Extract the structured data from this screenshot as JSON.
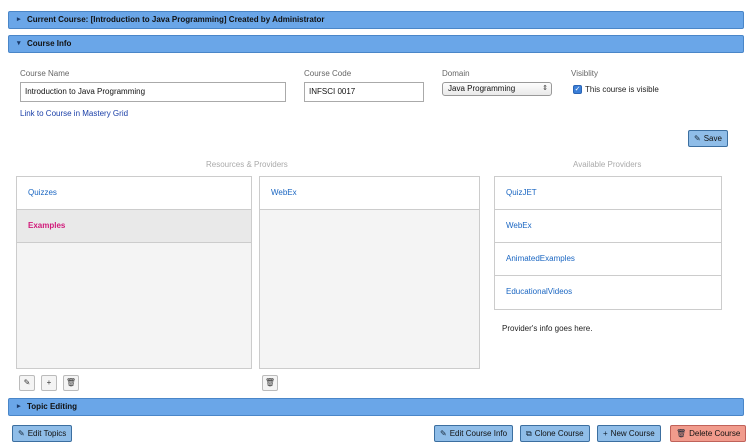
{
  "current_course_bar": {
    "label": "Current Course: [Introduction to Java Programming] Created by Administrator"
  },
  "course_info_bar": {
    "label": "Course Info"
  },
  "form": {
    "course_name_label": "Course Name",
    "course_name_value": "Introduction to Java Programming",
    "course_code_label": "Course Code",
    "course_code_value": "INFSCI 0017",
    "domain_label": "Domain",
    "domain_value": "Java Programming",
    "visibility_label": "Visiblity",
    "visible_checkbox_label": "This course is visible",
    "mastery_link": "Link to Course in Mastery Grid",
    "save_label": "Save"
  },
  "resources": {
    "heading": "Resources & Providers",
    "items": [
      {
        "label": "Quizzes"
      },
      {
        "label": "Examples"
      }
    ],
    "providers": [
      {
        "label": "WebEx"
      }
    ]
  },
  "available": {
    "heading": "Available Providers",
    "items": [
      {
        "label": "QuizJET"
      },
      {
        "label": "WebEx"
      },
      {
        "label": "AnimatedExamples"
      },
      {
        "label": "EducationalVideos"
      }
    ],
    "info_text": "Provider's info goes here."
  },
  "topic_bar": {
    "label": "Topic Editing"
  },
  "footer": {
    "edit_topics": "Edit Topics",
    "edit_course_info": "Edit Course Info",
    "clone_course": "Clone Course",
    "new_course": "New Course",
    "delete_course": "Delete Course"
  }
}
